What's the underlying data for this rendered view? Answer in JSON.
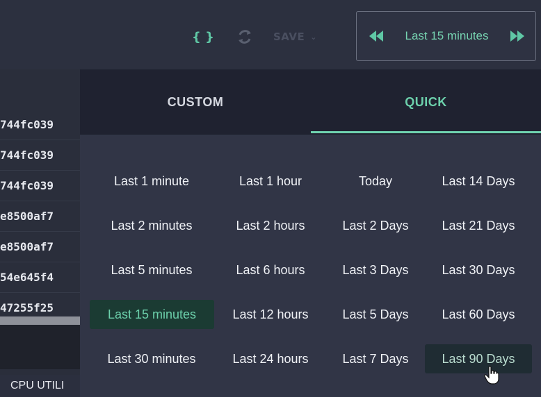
{
  "toolbar": {
    "json_icon": "{ }",
    "save_label": "SAVE",
    "colors": {
      "accent": "#6cd0ab",
      "disabled": "#4a4f60"
    }
  },
  "time_picker": {
    "label": "Last 15 minutes",
    "prev_icon": "double-left-arrow",
    "next_icon": "double-right-arrow"
  },
  "left_table": {
    "rows": [
      "744fc039",
      "744fc039",
      "744fc039",
      "e8500af7",
      "e8500af7",
      "54e645f4",
      "47255f25"
    ],
    "footer": "CPU UTILI"
  },
  "panel": {
    "tabs": [
      {
        "label": "CUSTOM",
        "active": false
      },
      {
        "label": "QUICK",
        "active": true
      }
    ],
    "options": [
      [
        "Last 1 minute",
        "Last 1 hour",
        "Today",
        "Last 14 Days"
      ],
      [
        "Last 2 minutes",
        "Last 2 hours",
        "Last 2 Days",
        "Last 21 Days"
      ],
      [
        "Last 5 minutes",
        "Last 6 hours",
        "Last 3 Days",
        "Last 30 Days"
      ],
      [
        "Last 15 minutes",
        "Last 12 hours",
        "Last 5 Days",
        "Last 60 Days"
      ],
      [
        "Last 30 minutes",
        "Last 24 hours",
        "Last 7 Days",
        "Last 90 Days"
      ]
    ],
    "selected": "Last 15 minutes",
    "hovered": "Last 90 Days"
  }
}
